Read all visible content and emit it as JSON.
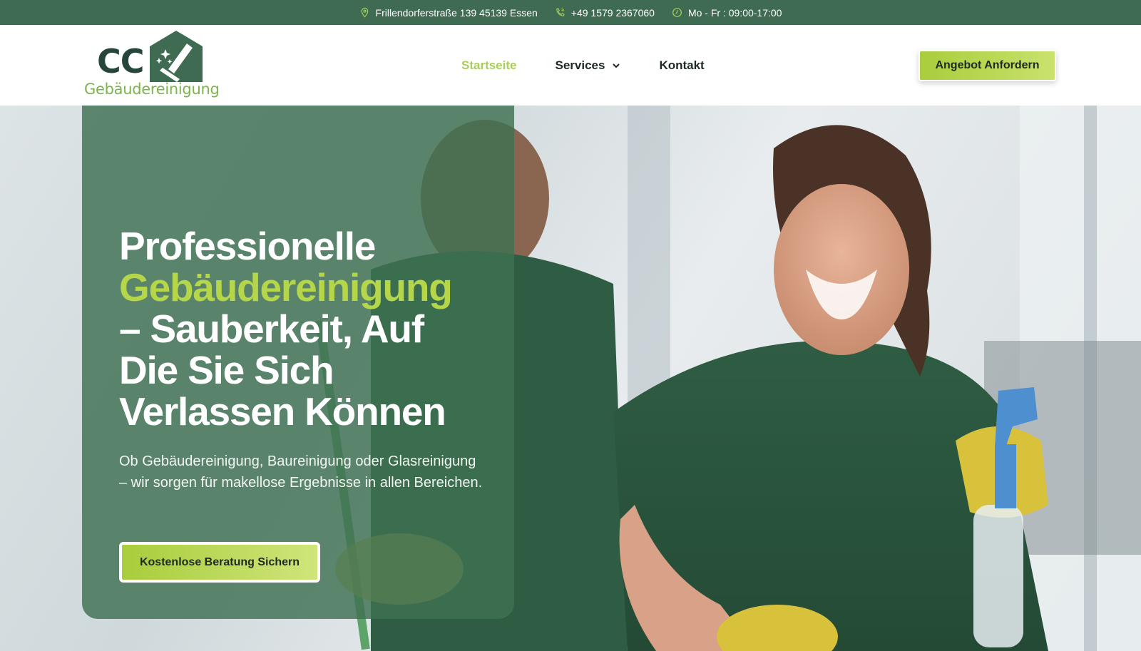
{
  "topbar": {
    "address": "Frillendorferstraße 139 45139 Essen",
    "phone": "+49 1579 2367060",
    "hours": "Mo - Fr : 09:00-17:00",
    "icons": [
      "location-pin-icon",
      "phone-icon",
      "clock-icon"
    ]
  },
  "logo": {
    "mark": "CC",
    "subtitle": "Gebäudereinigung"
  },
  "nav": {
    "items": [
      {
        "label": "Startseite",
        "active": true
      },
      {
        "label": "Services",
        "has_dropdown": true
      },
      {
        "label": "Kontakt"
      }
    ]
  },
  "header_cta": "Angebot Anfordern",
  "hero": {
    "title_line1": "Professionelle",
    "title_accent": "Gebäudereinigung",
    "title_line3": "– Sauberkeit, Auf",
    "title_line4": "Die Sie Sich",
    "title_line5": "Verlassen Können",
    "description": "Ob Gebäudereinigung, Baureinigung oder Glasreinigung – wir sorgen für makellose Ergebnisse in allen Bereichen.",
    "cta": "Kostenlose Beratung Sichern"
  },
  "colors": {
    "brand_green": "#3e6b52",
    "accent_lime": "#a9cd3c",
    "logo_dark": "#27463a"
  }
}
